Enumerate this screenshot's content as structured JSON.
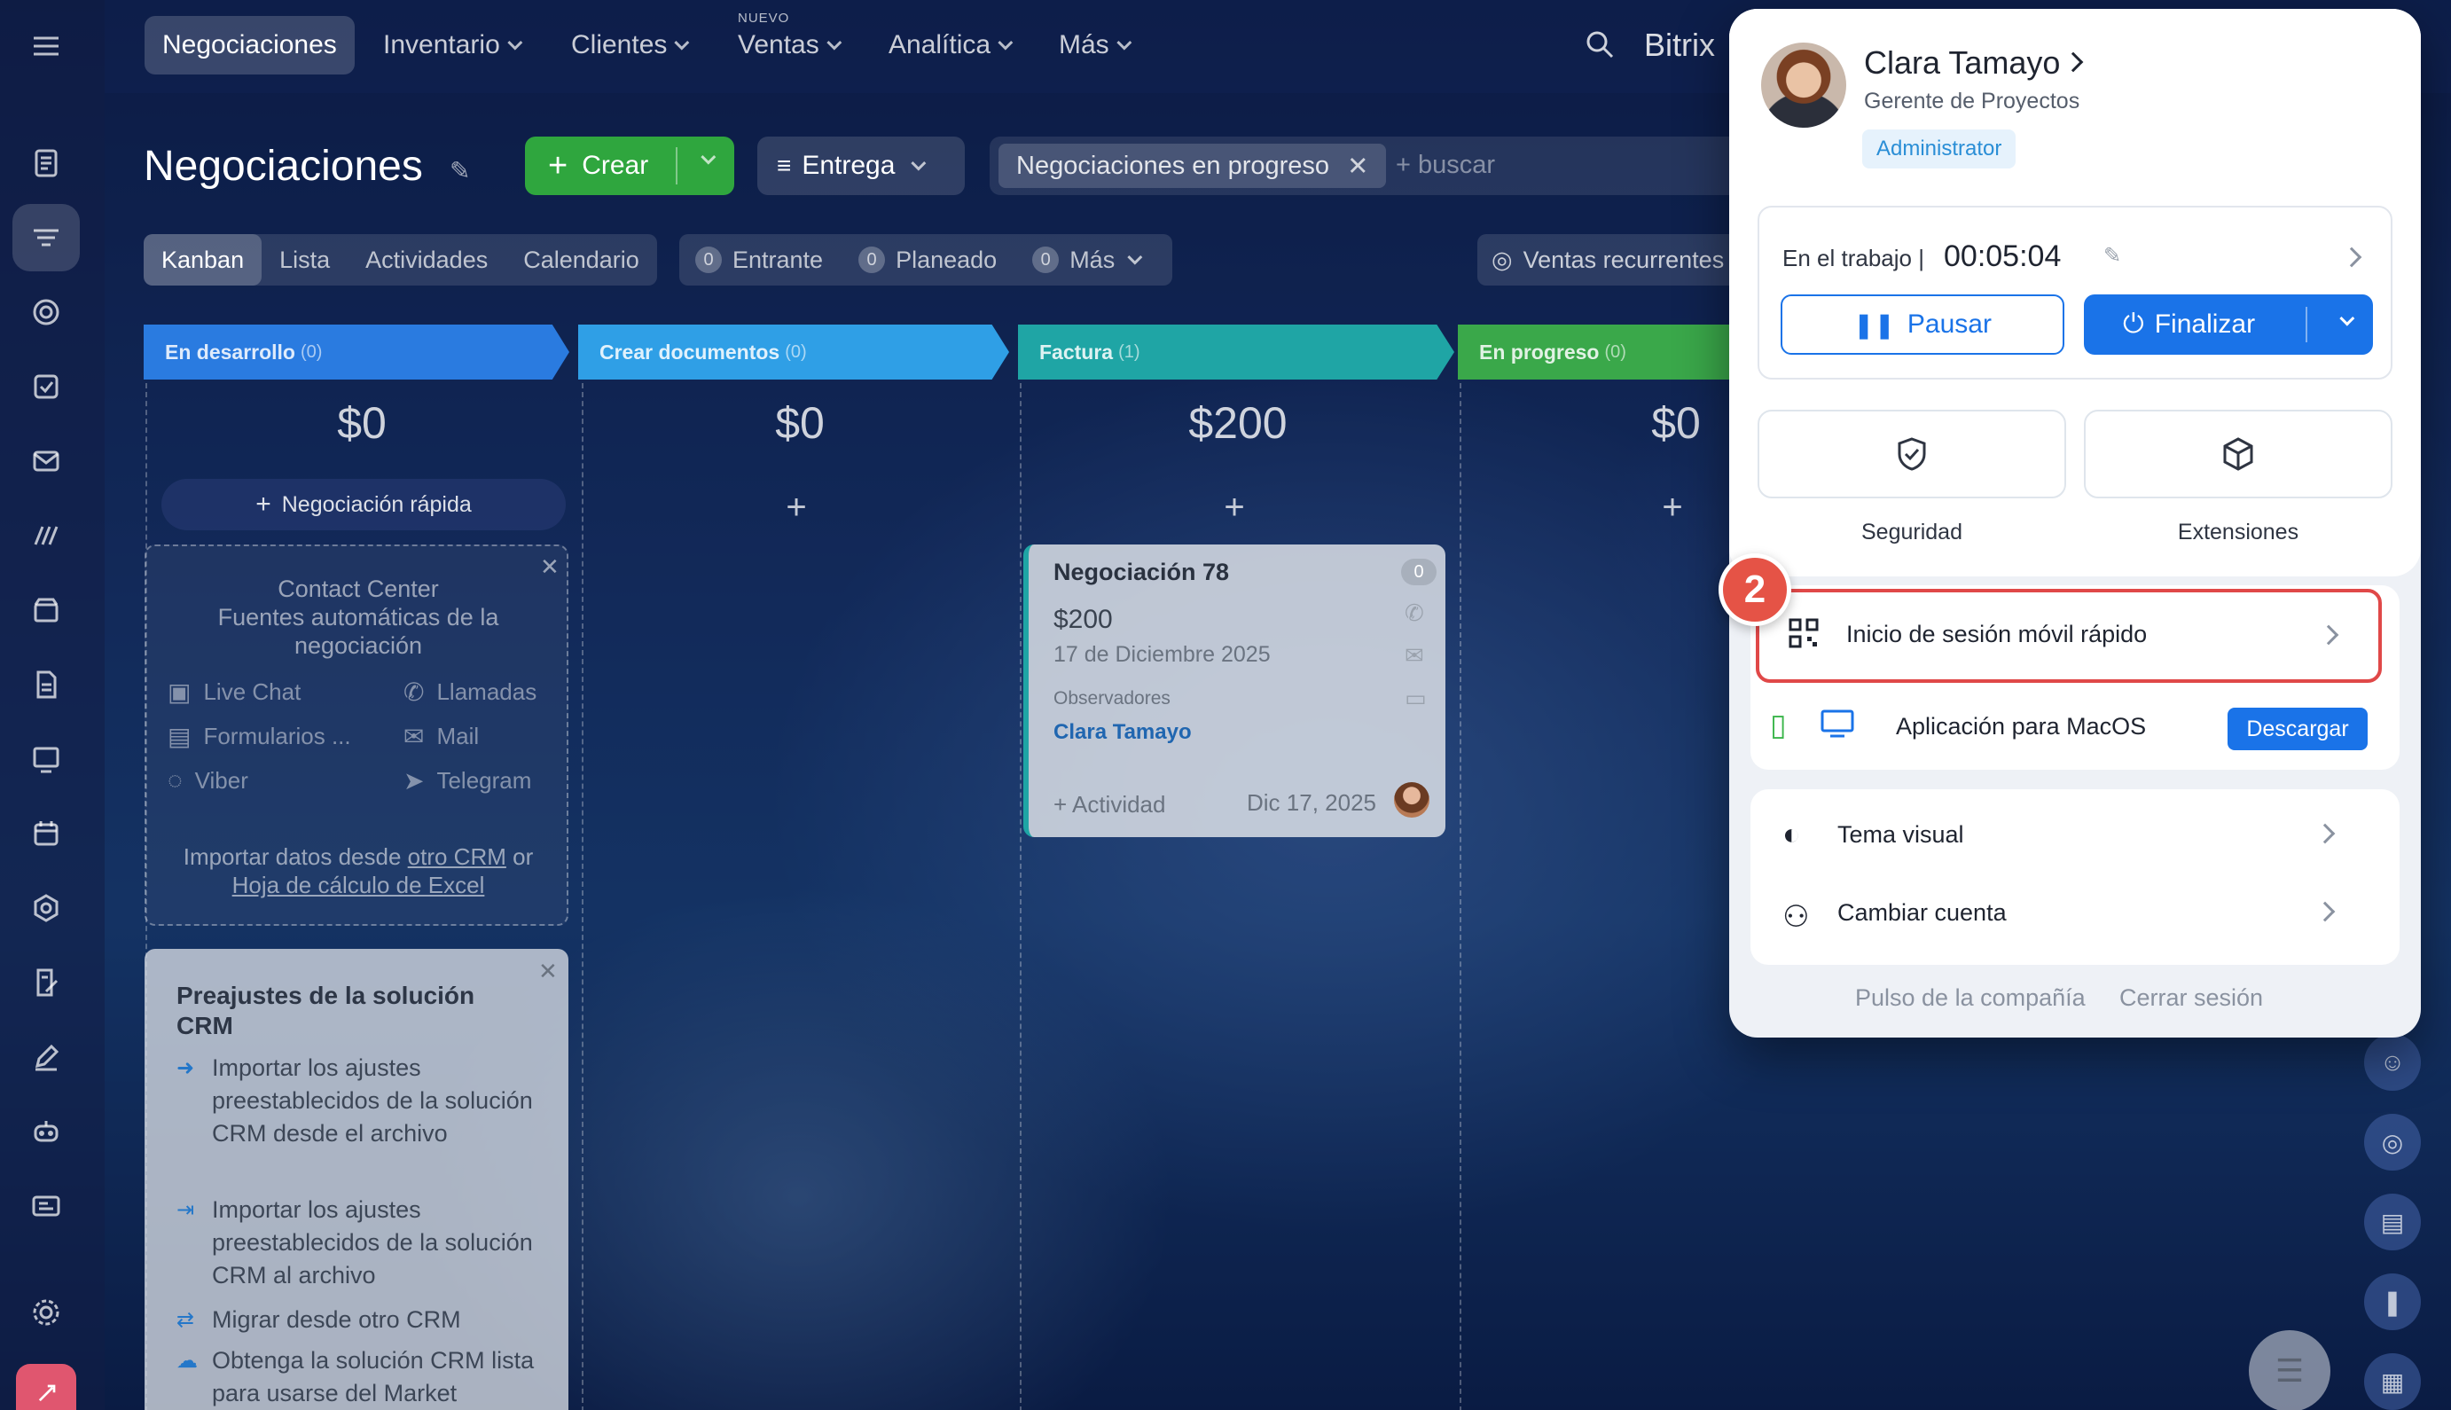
{
  "topnav": {
    "items": [
      "Negociaciones",
      "Inventario",
      "Clientes",
      "Ventas",
      "Analítica",
      "Más"
    ],
    "ventas_badge": "NUEVO",
    "brand": "Bitrix"
  },
  "page": {
    "title": "Negociaciones",
    "create_label": "Crear",
    "pipeline_label": "Entrega",
    "filter_chip": "Negociaciones en progreso",
    "search_placeholder": "+ buscar"
  },
  "views": [
    "Kanban",
    "Lista",
    "Actividades",
    "Calendario"
  ],
  "counters": [
    {
      "count": "0",
      "label": "Entrante"
    },
    {
      "count": "0",
      "label": "Planeado"
    },
    {
      "count": "0",
      "label": "Más"
    }
  ],
  "recurring_label": "Ventas recurrentes",
  "stages": [
    {
      "name": "En desarrollo",
      "count": "(0)",
      "sum": "$0",
      "color": "#2a7be0"
    },
    {
      "name": "Crear documentos",
      "count": "(0)",
      "sum": "$0",
      "color": "#2f9fe6"
    },
    {
      "name": "Factura",
      "count": "(1)",
      "sum": "$200",
      "color": "#1fa5a5"
    },
    {
      "name": "En progreso",
      "count": "(0)",
      "sum": "$0",
      "color": "#3aa84a"
    }
  ],
  "quick_deal_label": "Negociación rápida",
  "contact_center": {
    "title_line1": "Contact Center",
    "title_line2": "Fuentes automáticas de la",
    "title_line3": "negociación",
    "items": [
      "Live Chat",
      "Llamadas",
      "Formularios ...",
      "Mail",
      "Viber",
      "Telegram"
    ],
    "import_prefix": "Importar datos desde",
    "link_other_crm": "otro CRM",
    "or": "or",
    "link_excel": "Hoja de cálculo de Excel"
  },
  "presets": {
    "title": "Preajustes de la solución CRM",
    "items": [
      "Importar los ajustes preestablecidos de la solución CRM desde el archivo",
      "Importar los ajustes preestablecidos de la solución CRM al archivo",
      "Migrar desde otro CRM",
      "Obtenga la solución CRM lista para usarse del Market"
    ]
  },
  "deal": {
    "title": "Negociación 78",
    "badge": "0",
    "price": "$200",
    "date": "17 de Diciembre 2025",
    "observers_label": "Observadores",
    "observer": "Clara Tamayo",
    "activity": "+ Actividad",
    "deadline": "Dic 17, 2025"
  },
  "profile": {
    "name": "Clara Tamayo",
    "role": "Gerente de Proyectos",
    "badge": "Administrator",
    "work_label": "En el trabajo |",
    "timer": "00:05:04",
    "pause_label": "Pausar",
    "finish_label": "Finalizar",
    "tiles": [
      "Seguridad",
      "Extensiones"
    ],
    "qr_login": "Inicio de sesión móvil rápido",
    "mac_app": "Aplicación para MacOS",
    "download": "Descargar",
    "theme": "Tema visual",
    "switch_account": "Cambiar cuenta",
    "footer_pulse": "Pulso de la compañía",
    "footer_logout": "Cerrar sesión"
  },
  "step_marker": "2",
  "colors": {
    "accent": "#1a73e8",
    "create": "#2fa63e",
    "highlight": "#e04848"
  }
}
